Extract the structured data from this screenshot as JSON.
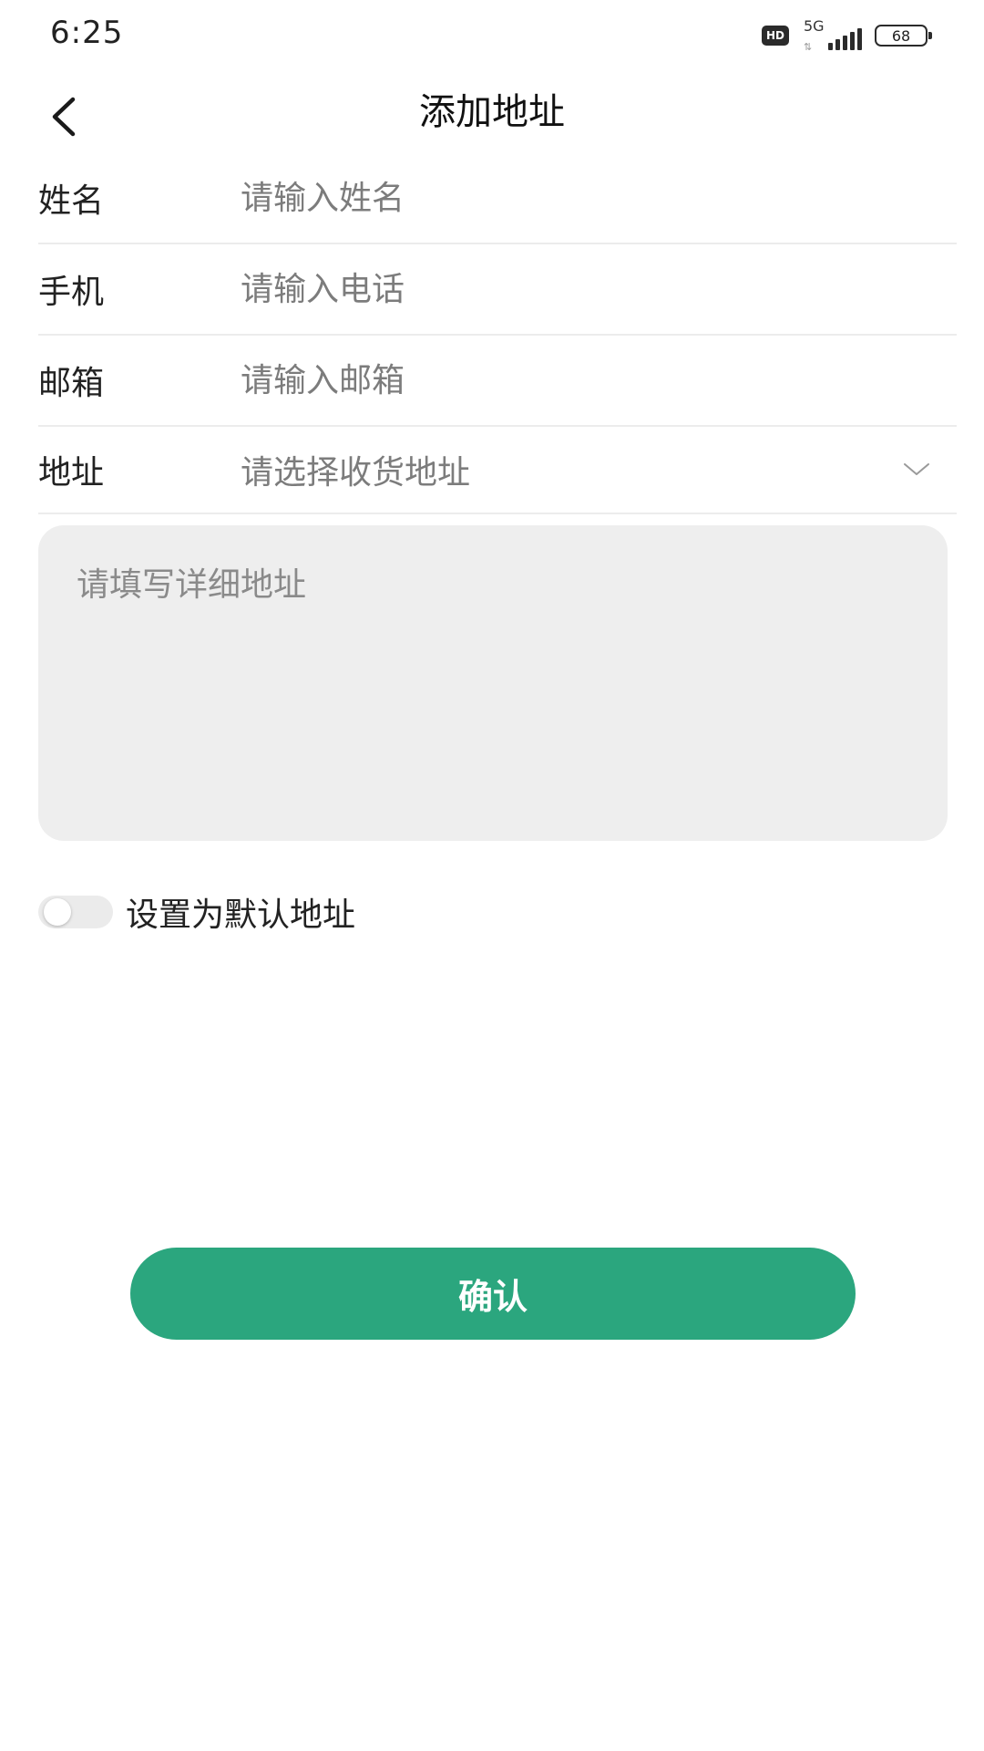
{
  "status_bar": {
    "time": "6:25",
    "hd_badge": "HD",
    "network": "5G",
    "network_arrows": "⇅",
    "battery": "68"
  },
  "nav": {
    "title": "添加地址",
    "back_icon": "chevron-left-icon"
  },
  "form": {
    "name": {
      "label": "姓名",
      "placeholder": "请输入姓名",
      "value": ""
    },
    "phone": {
      "label": "手机",
      "placeholder": "请输入电话",
      "value": ""
    },
    "email": {
      "label": "邮箱",
      "placeholder": "请输入邮箱",
      "value": ""
    },
    "address": {
      "label": "地址",
      "placeholder": "请选择收货地址",
      "icon": "chevron-down-icon"
    }
  },
  "detail": {
    "placeholder": "请填写详细地址",
    "value": ""
  },
  "default_toggle": {
    "label": "设置为默认地址",
    "checked": false
  },
  "confirm_button": {
    "label": "确认"
  },
  "colors": {
    "accent": "#2ba67e",
    "textarea_bg": "#eeeeee",
    "divider": "#ececec",
    "placeholder": "#7c7c7c"
  }
}
